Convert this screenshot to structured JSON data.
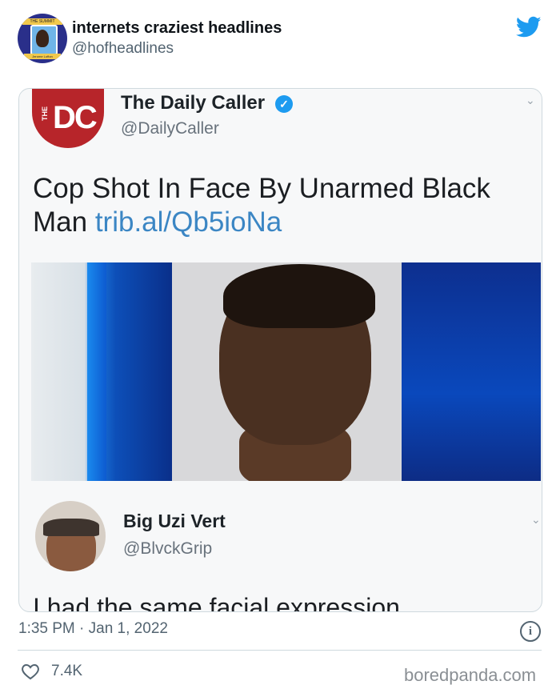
{
  "tweet": {
    "author_name": "internets craziest headlines",
    "author_handle": "@hofheadlines",
    "avatar_caption_top": "THE SUMMIT",
    "avatar_caption_bottom": "Jerome Lofton",
    "timestamp": "1:35 PM · Jan 1, 2022",
    "likes": "7.4K",
    "brand_color": "#1d9bf0"
  },
  "embedded": {
    "logo_text": "DC",
    "logo_side_text": "THE",
    "logo_color": "#b7252a",
    "source_name": "The Daily Caller",
    "verified_mark": "✓",
    "source_handle": "@DailyCaller",
    "headline_text": "Cop Shot In Face By Unarmed Black Man",
    "headline_link": "trib.al/Qb5ioNa",
    "reply_name": "Big Uzi Vert",
    "reply_handle": "@BlvckGrip",
    "reply_text": "I had the same facial expression"
  },
  "icons": {
    "chevron": "⌄",
    "info": "i"
  },
  "watermark": "boredpanda.com"
}
